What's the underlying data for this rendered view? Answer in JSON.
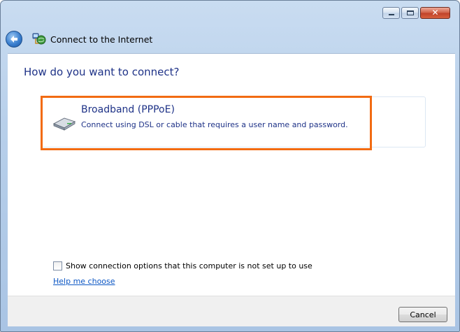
{
  "window": {
    "title": "Connect to the Internet",
    "minimize_glyph": "",
    "maximize_glyph": "",
    "close_glyph": "✕"
  },
  "main": {
    "question": "How do you want to connect?",
    "options": [
      {
        "title": "Broadband (PPPoE)",
        "description": "Connect using DSL or cable that requires a user name and password.",
        "icon": "broadband-modem-icon"
      }
    ],
    "show_options_label": "Show connection options that this computer is not set up to use",
    "show_options_checked": false,
    "help_link": "Help me choose"
  },
  "footer": {
    "cancel_label": "Cancel"
  },
  "colors": {
    "instruction_text": "#1e3287",
    "highlight": "#f26b12",
    "link": "#0b56c4"
  }
}
